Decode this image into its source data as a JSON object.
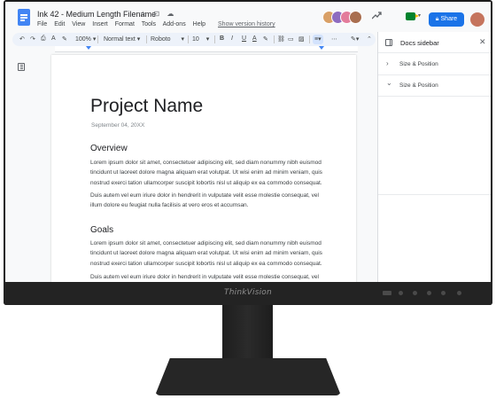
{
  "app": {
    "doc_title": "Ink 42 - Medium Length Filename",
    "title_icons": "☆ ⊡ ☁"
  },
  "menu": {
    "items": [
      "File",
      "Edit",
      "View",
      "Insert",
      "Format",
      "Tools",
      "Add-ons",
      "Help"
    ],
    "history_link": "Show version history"
  },
  "header": {
    "share_label": "Share",
    "share_icon": "lock-icon",
    "trend_icon": "trending-icon",
    "meet_icon": "meet-icon",
    "avatar_colors": [
      "#d9a066",
      "#8e6cc0",
      "#e37c9b",
      "#a96e4f"
    ],
    "accent": "#1a73e8"
  },
  "toolbar": {
    "undo": "↶",
    "redo": "↷",
    "print": "⎙",
    "spell": "A",
    "paint": "✎",
    "zoom": "100%",
    "zoom_caret": "▾",
    "style": "Normal text",
    "style_caret": "▾",
    "font": "Roboto",
    "font_caret": "▾",
    "size": "10",
    "size_caret": "▾",
    "bold": "B",
    "italic": "I",
    "underline": "U",
    "text_color": "A",
    "highlight": "✎",
    "link": "⛓",
    "comment": "▭",
    "image": "▨",
    "align": "≡",
    "align_caret": "▾",
    "more": "⋯",
    "edit_mode": "✎",
    "edit_caret": "▾",
    "collapse": "⌃"
  },
  "document": {
    "title": "Project Name",
    "date": "September 04, 20XX",
    "sections": [
      {
        "heading": "Overview",
        "paragraphs": [
          "Lorem ipsum dolor sit amet, consectetuer adipiscing elit, sed diam nonummy nibh euismod tincidunt ut laoreet dolore magna aliquam erat volutpat. Ut wisi enim ad minim veniam, quis nostrud exerci tation ullamcorper suscipit lobortis nisl ut aliquip ex ea commodo consequat.",
          "Duis autem vel eum iriure dolor in hendrerit in vulputate velit esse molestie consequat, vel illum dolore eu feugiat nulla facilisis at vero eros et accumsan."
        ]
      },
      {
        "heading": "Goals",
        "paragraphs": [
          "Lorem ipsum dolor sit amet, consectetuer adipiscing elit, sed diam nonummy nibh euismod tincidunt ut laoreet dolore magna aliquam erat volutpat. Ut wisi enim ad minim veniam, quis nostrud exerci tation ullamcorper suscipit lobortis nisl ut aliquip ex ea commodo consequat.",
          "Duis autem vel eum iriure dolor in hendrerit in vulputate velit esse molestie consequat, vel"
        ]
      }
    ]
  },
  "sidebar": {
    "title": "Docs sidebar",
    "close": "✕",
    "sections": [
      {
        "label": "Size & Position",
        "chevron": "›",
        "expanded": false
      },
      {
        "label": "Size & Position",
        "chevron": "⌄",
        "expanded": true
      }
    ]
  },
  "monitor": {
    "brand": "ThinkVision"
  }
}
